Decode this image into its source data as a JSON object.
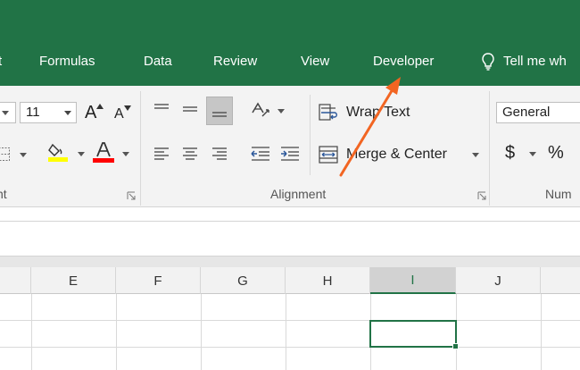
{
  "tabs": {
    "partial_left": "t",
    "formulas": "Formulas",
    "data": "Data",
    "review": "Review",
    "view": "View",
    "developer": "Developer",
    "tell_me": "Tell me wh"
  },
  "font": {
    "size_value": "11",
    "grow_label": "A",
    "shrink_label": "A"
  },
  "alignment": {
    "wrap_text_label": "Wrap Text",
    "merge_center_label": "Merge & Center",
    "group_label": "Alignment"
  },
  "font_group_label_partial": "nt",
  "number": {
    "format_value": "General",
    "currency_symbol": "$",
    "percent_symbol": "%",
    "group_label_partial": "Num"
  },
  "columns": [
    "E",
    "F",
    "G",
    "H",
    "I",
    "J"
  ],
  "colors": {
    "excel_green": "#217346",
    "annotation_orange": "#f26522",
    "highlight_yellow": "#ffff00",
    "font_red": "#ff0000"
  }
}
